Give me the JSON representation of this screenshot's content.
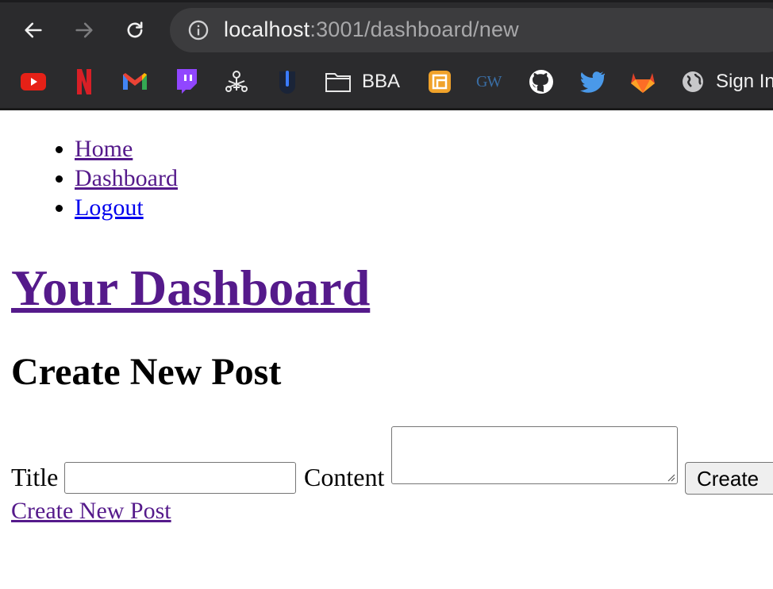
{
  "browser": {
    "url_host": "localhost",
    "url_rest": ":3001/dashboard/new",
    "bookmarks": [
      {
        "icon": "youtube-icon"
      },
      {
        "icon": "netflix-icon"
      },
      {
        "icon": "gmail-icon"
      },
      {
        "icon": "twitch-icon"
      },
      {
        "icon": "keys-icon"
      },
      {
        "icon": "dark-shield-icon"
      },
      {
        "icon": "folder-icon",
        "label": "BBA"
      },
      {
        "icon": "orange-app-icon"
      },
      {
        "icon": "gw-icon",
        "text": "GW"
      },
      {
        "icon": "github-icon"
      },
      {
        "icon": "twitter-icon"
      },
      {
        "icon": "gitlab-icon"
      },
      {
        "icon": "globe-icon",
        "label": "Sign In"
      }
    ]
  },
  "nav": {
    "home": "Home",
    "dashboard": "Dashboard",
    "logout": "Logout"
  },
  "page": {
    "heading": "Your Dashboard",
    "subheading": "Create New Post"
  },
  "form": {
    "title_label": "Title",
    "title_value": "",
    "content_label": "Content",
    "content_value": "",
    "submit_label": "Create"
  },
  "footer_link": "Create New Post",
  "colors": {
    "link": "#0000ee",
    "visited_link": "#551a8b",
    "chrome_bg": "#2b2b2d"
  }
}
